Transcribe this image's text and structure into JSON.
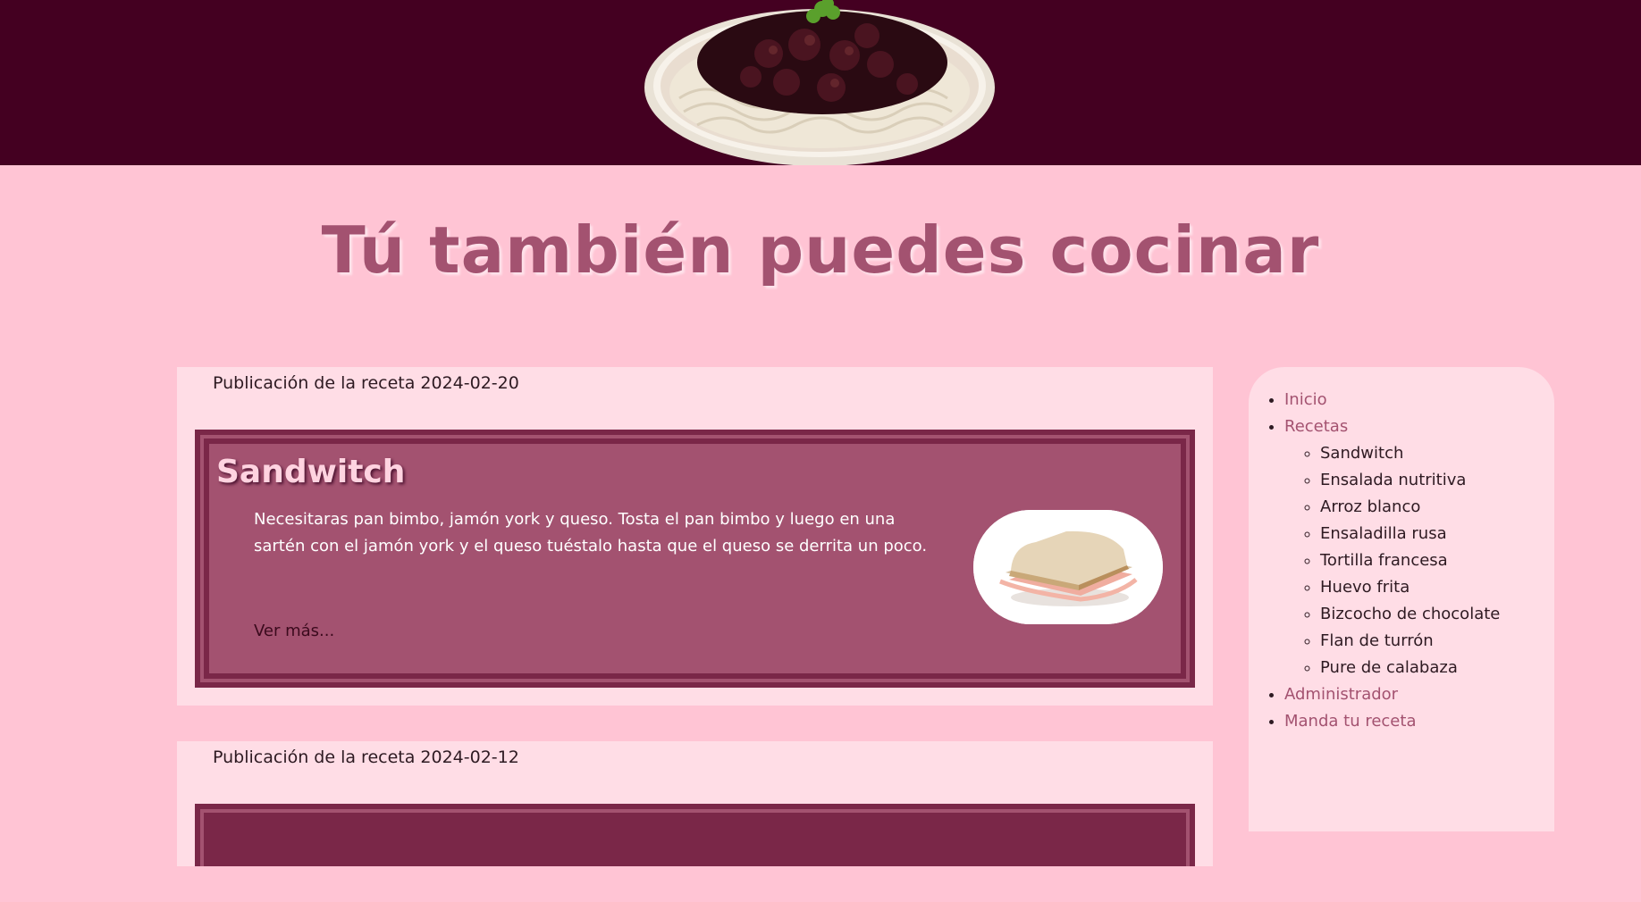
{
  "site": {
    "title": "Tú también puedes cocinar"
  },
  "header": {
    "banner_image": "plate-of-noodles-with-sauce",
    "background_color": "#440021"
  },
  "posts": [
    {
      "meta": "Publicación de la receta 2024-02-20",
      "title": "Sandwitch",
      "description": "Necesitaras pan bimbo, jamón york y queso. Tosta el pan bimbo y luego en una sartén con el jamón york y el queso tuéstalo hasta que el queso se derrita un poco.",
      "more_label": "Ver más...",
      "image": "ham-sandwich-photo"
    },
    {
      "meta": "Publicación de la receta 2024-02-12"
    }
  ],
  "nav": {
    "items": [
      {
        "label": "Inicio"
      },
      {
        "label": "Recetas"
      },
      {
        "label": "Administrador"
      },
      {
        "label": "Manda tu receta"
      }
    ],
    "recipes": [
      "Sandwitch",
      "Ensalada nutritiva",
      "Arroz blanco",
      "Ensaladilla rusa",
      "Tortilla francesa",
      "Huevo frita",
      "Bizcocho de chocolate",
      "Flan de turrón",
      "Pure de calabaza"
    ]
  },
  "colors": {
    "page_background": "#ffc4d4",
    "accent": "#a35270",
    "card_border": "#7a2748",
    "panel": "#ffdde6"
  }
}
